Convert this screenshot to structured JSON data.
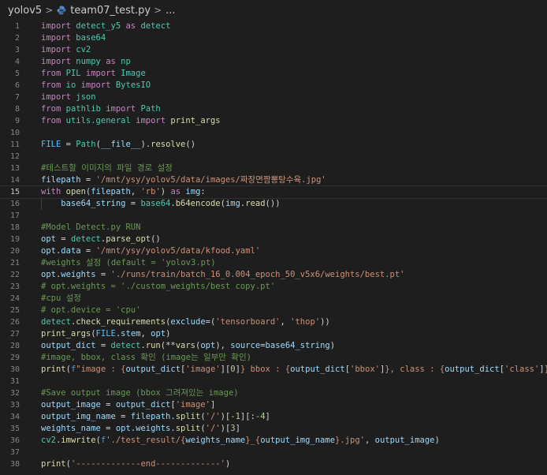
{
  "breadcrumb": {
    "folder": "yolov5",
    "file": "team07_test.py",
    "ellipsis": "...",
    "separator": ">"
  },
  "editor": {
    "active_line": 15,
    "lines": [
      {
        "n": "1",
        "t": [
          [
            "import",
            "kw"
          ],
          [
            " detect_y5 ",
            "mod"
          ],
          [
            "as",
            "kw"
          ],
          [
            " detect",
            "mod"
          ]
        ]
      },
      {
        "n": "2",
        "t": [
          [
            "import",
            "kw"
          ],
          [
            " base64",
            "mod"
          ]
        ]
      },
      {
        "n": "3",
        "t": [
          [
            "import",
            "kw"
          ],
          [
            " cv2",
            "mod"
          ]
        ]
      },
      {
        "n": "4",
        "t": [
          [
            "import",
            "kw"
          ],
          [
            " numpy ",
            "mod"
          ],
          [
            "as",
            "kw"
          ],
          [
            " np",
            "mod"
          ]
        ]
      },
      {
        "n": "5",
        "t": [
          [
            "from",
            "kw"
          ],
          [
            " PIL ",
            "mod"
          ],
          [
            "import",
            "kw"
          ],
          [
            " Image",
            "mod"
          ]
        ]
      },
      {
        "n": "6",
        "t": [
          [
            "from",
            "kw"
          ],
          [
            " io ",
            "mod"
          ],
          [
            "import",
            "kw"
          ],
          [
            " BytesIO",
            "mod"
          ]
        ]
      },
      {
        "n": "7",
        "t": [
          [
            "import",
            "kw"
          ],
          [
            " json",
            "mod"
          ]
        ]
      },
      {
        "n": "8",
        "t": [
          [
            "from",
            "kw"
          ],
          [
            " pathlib ",
            "mod"
          ],
          [
            "import",
            "kw"
          ],
          [
            " Path",
            "mod"
          ]
        ]
      },
      {
        "n": "9",
        "t": [
          [
            "from",
            "kw"
          ],
          [
            " utils.general ",
            "mod"
          ],
          [
            "import",
            "kw"
          ],
          [
            " print_args",
            "fn"
          ]
        ]
      },
      {
        "n": "10",
        "t": []
      },
      {
        "n": "11",
        "t": [
          [
            "FILE",
            "cons"
          ],
          [
            " = ",
            "pl"
          ],
          [
            "Path",
            "mod"
          ],
          [
            "(",
            "pl"
          ],
          [
            "__file__",
            "var"
          ],
          [
            ").",
            "pl"
          ],
          [
            "resolve",
            "fn"
          ],
          [
            "()",
            "pl"
          ]
        ]
      },
      {
        "n": "12",
        "t": []
      },
      {
        "n": "13",
        "t": [
          [
            "#테스트할 이미지의 파일 경로 설정",
            "cmt"
          ]
        ]
      },
      {
        "n": "14",
        "t": [
          [
            "filepath",
            "var"
          ],
          [
            " = ",
            "pl"
          ],
          [
            "'/mnt/ysy/yolov5/data/images/짜장면짬뽕탕수육.jpg'",
            "str"
          ]
        ]
      },
      {
        "n": "15",
        "t": [
          [
            "with",
            "kw"
          ],
          [
            " ",
            "pl"
          ],
          [
            "open",
            "fn"
          ],
          [
            "(",
            "pl"
          ],
          [
            "filepath",
            "var"
          ],
          [
            ", ",
            "pl"
          ],
          [
            "'rb'",
            "str"
          ],
          [
            ") ",
            "pl"
          ],
          [
            "as",
            "kw"
          ],
          [
            " ",
            "pl"
          ],
          [
            "img",
            "var"
          ],
          [
            ":",
            "pl"
          ]
        ]
      },
      {
        "n": "16",
        "t": [
          [
            "    ",
            "pl"
          ],
          [
            "base64_string",
            "var"
          ],
          [
            " = ",
            "pl"
          ],
          [
            "base64",
            "mod"
          ],
          [
            ".",
            "pl"
          ],
          [
            "b64encode",
            "fn"
          ],
          [
            "(",
            "pl"
          ],
          [
            "img",
            "var"
          ],
          [
            ".",
            "pl"
          ],
          [
            "read",
            "fn"
          ],
          [
            "())",
            "pl"
          ]
        ],
        "indent": true
      },
      {
        "n": "17",
        "t": []
      },
      {
        "n": "18",
        "t": [
          [
            "#Model Detect.py RUN",
            "cmt"
          ]
        ]
      },
      {
        "n": "19",
        "t": [
          [
            "opt",
            "var"
          ],
          [
            " = ",
            "pl"
          ],
          [
            "detect",
            "mod"
          ],
          [
            ".",
            "pl"
          ],
          [
            "parse_opt",
            "fn"
          ],
          [
            "()",
            "pl"
          ]
        ]
      },
      {
        "n": "20",
        "t": [
          [
            "opt",
            "var"
          ],
          [
            ".",
            "pl"
          ],
          [
            "data",
            "var"
          ],
          [
            " = ",
            "pl"
          ],
          [
            "'/mnt/ysy/yolov5/data/kfood.yaml'",
            "str"
          ]
        ]
      },
      {
        "n": "21",
        "t": [
          [
            "#weights 설정 (default = 'yolov3.pt)",
            "cmt"
          ]
        ]
      },
      {
        "n": "22",
        "t": [
          [
            "opt",
            "var"
          ],
          [
            ".",
            "pl"
          ],
          [
            "weights",
            "var"
          ],
          [
            " = ",
            "pl"
          ],
          [
            "'./runs/train/batch_16_0.004_epoch_50_v5x6/weights/best.pt'",
            "str"
          ]
        ]
      },
      {
        "n": "23",
        "t": [
          [
            "# opt.weights = './custom_weights/best copy.pt'",
            "cmt"
          ]
        ]
      },
      {
        "n": "24",
        "t": [
          [
            "#cpu 설정",
            "cmt"
          ]
        ]
      },
      {
        "n": "25",
        "t": [
          [
            "# opt.device = 'cpu'",
            "cmt"
          ]
        ]
      },
      {
        "n": "26",
        "t": [
          [
            "detect",
            "mod"
          ],
          [
            ".",
            "pl"
          ],
          [
            "check_requirements",
            "fn"
          ],
          [
            "(",
            "pl"
          ],
          [
            "exclude",
            "var"
          ],
          [
            "=(",
            "pl"
          ],
          [
            "'tensorboard'",
            "str"
          ],
          [
            ", ",
            "pl"
          ],
          [
            "'thop'",
            "str"
          ],
          [
            "))",
            "pl"
          ]
        ]
      },
      {
        "n": "27",
        "t": [
          [
            "print_args",
            "fn"
          ],
          [
            "(",
            "pl"
          ],
          [
            "FILE",
            "cons"
          ],
          [
            ".",
            "pl"
          ],
          [
            "stem",
            "var"
          ],
          [
            ", ",
            "pl"
          ],
          [
            "opt",
            "var"
          ],
          [
            ")",
            "pl"
          ]
        ]
      },
      {
        "n": "28",
        "t": [
          [
            "output_dict",
            "var"
          ],
          [
            " = ",
            "pl"
          ],
          [
            "detect",
            "mod"
          ],
          [
            ".",
            "pl"
          ],
          [
            "run",
            "fn"
          ],
          [
            "(**",
            "pl"
          ],
          [
            "vars",
            "fn"
          ],
          [
            "(",
            "pl"
          ],
          [
            "opt",
            "var"
          ],
          [
            "), ",
            "pl"
          ],
          [
            "source",
            "var"
          ],
          [
            "=",
            "pl"
          ],
          [
            "base64_string",
            "var"
          ],
          [
            ")",
            "pl"
          ]
        ]
      },
      {
        "n": "29",
        "t": [
          [
            "#image, bbox, class 확인 (image는 일부만 확인)",
            "cmt"
          ]
        ]
      },
      {
        "n": "30",
        "t": [
          [
            "print",
            "fn"
          ],
          [
            "(",
            "pl"
          ],
          [
            "f",
            "bl"
          ],
          [
            "\"image : {",
            "str"
          ],
          [
            "output_dict",
            "var"
          ],
          [
            "[",
            "pl"
          ],
          [
            "'image'",
            "str"
          ],
          [
            "][",
            "pl"
          ],
          [
            "0",
            "num"
          ],
          [
            "]",
            "pl"
          ],
          [
            "} bbox : {",
            "str"
          ],
          [
            "output_dict",
            "var"
          ],
          [
            "[",
            "pl"
          ],
          [
            "'bbox'",
            "str"
          ],
          [
            "]",
            "pl"
          ],
          [
            "}, class : {",
            "str"
          ],
          [
            "output_dict",
            "var"
          ],
          [
            "[",
            "pl"
          ],
          [
            "'class'",
            "str"
          ],
          [
            "]",
            "pl"
          ],
          [
            "}\"",
            "str"
          ],
          [
            ")",
            "pl"
          ]
        ]
      },
      {
        "n": "31",
        "t": []
      },
      {
        "n": "32",
        "t": [
          [
            "#Save output image (bbox 그려져있는 image)",
            "cmt"
          ]
        ]
      },
      {
        "n": "33",
        "t": [
          [
            "output_image",
            "var"
          ],
          [
            " = ",
            "pl"
          ],
          [
            "output_dict",
            "var"
          ],
          [
            "[",
            "pl"
          ],
          [
            "'image'",
            "str"
          ],
          [
            "]",
            "pl"
          ]
        ]
      },
      {
        "n": "34",
        "t": [
          [
            "output_img_name",
            "var"
          ],
          [
            " = ",
            "pl"
          ],
          [
            "filepath",
            "var"
          ],
          [
            ".",
            "pl"
          ],
          [
            "split",
            "fn"
          ],
          [
            "(",
            "pl"
          ],
          [
            "'/'",
            "str"
          ],
          [
            ")[",
            "pl"
          ],
          [
            "-1",
            "num"
          ],
          [
            "][:",
            "pl"
          ],
          [
            "-4",
            "num"
          ],
          [
            "]",
            "pl"
          ]
        ]
      },
      {
        "n": "35",
        "t": [
          [
            "weights_name",
            "var"
          ],
          [
            " = ",
            "pl"
          ],
          [
            "opt",
            "var"
          ],
          [
            ".",
            "pl"
          ],
          [
            "weights",
            "var"
          ],
          [
            ".",
            "pl"
          ],
          [
            "split",
            "fn"
          ],
          [
            "(",
            "pl"
          ],
          [
            "'/'",
            "str"
          ],
          [
            ")[",
            "pl"
          ],
          [
            "3",
            "num"
          ],
          [
            "]",
            "pl"
          ]
        ]
      },
      {
        "n": "36",
        "t": [
          [
            "cv2",
            "mod"
          ],
          [
            ".",
            "pl"
          ],
          [
            "imwrite",
            "fn"
          ],
          [
            "(",
            "pl"
          ],
          [
            "f",
            "bl"
          ],
          [
            "'./test_result/{",
            "str"
          ],
          [
            "weights_name",
            "var"
          ],
          [
            "}_{",
            "str"
          ],
          [
            "output_img_name",
            "var"
          ],
          [
            "}.jpg'",
            "str"
          ],
          [
            ", ",
            "pl"
          ],
          [
            "output_image",
            "var"
          ],
          [
            ")",
            "pl"
          ]
        ]
      },
      {
        "n": "37",
        "t": []
      },
      {
        "n": "38",
        "t": [
          [
            "print",
            "fn"
          ],
          [
            "(",
            "pl"
          ],
          [
            "'-------------end-------------'",
            "str"
          ],
          [
            ")",
            "pl"
          ]
        ]
      }
    ]
  },
  "colors": {
    "background": "#1e1e1e",
    "keyword": "#c586c0",
    "function": "#dcdcaa",
    "variable": "#9cdcfe",
    "string": "#ce9178",
    "comment": "#6a9955",
    "module": "#4ec9b0"
  },
  "icons": {
    "breadcrumb_separator": "chevron-right-icon",
    "file_icon": "python-file-icon"
  }
}
